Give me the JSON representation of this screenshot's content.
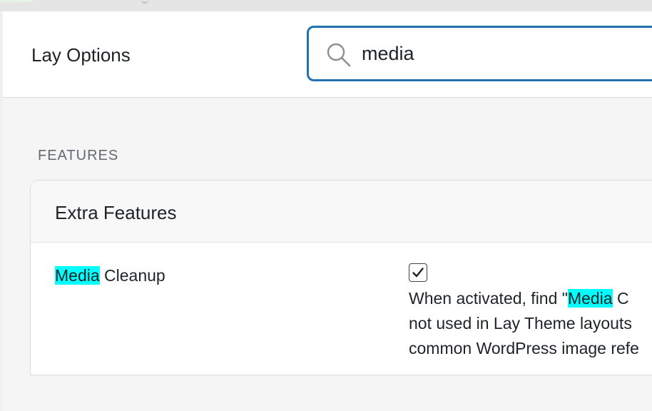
{
  "header": {
    "title": "Lay Options",
    "search": {
      "value": "media",
      "icon": "search-icon"
    }
  },
  "section": {
    "heading": "FEATURES"
  },
  "card": {
    "title": "Extra Features",
    "option": {
      "label_highlight": "Media",
      "label_rest": " Cleanup",
      "checked": true,
      "description": {
        "line1_before": "When activated, find \"",
        "line1_highlight": "Media",
        "line1_after": " C",
        "line2": "not used in Lay Theme layouts",
        "line3": "common WordPress image refe"
      }
    }
  },
  "colors": {
    "accent": "#2271b1",
    "highlight": "#00ffff"
  }
}
